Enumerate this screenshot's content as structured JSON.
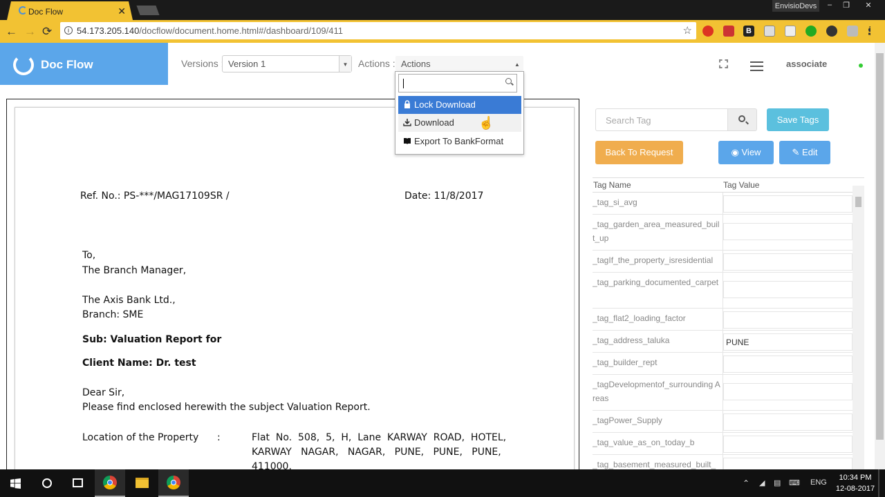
{
  "browser": {
    "tab_title": "Doc Flow",
    "tab_close": "✕",
    "window_user": "EnvisioDevs",
    "minimize": "–",
    "restore": "❐",
    "close": "✕",
    "back": "←",
    "forward": "→",
    "reload": "⟳",
    "url_host": "54.173.205.140",
    "url_path": "/docflow/document.home.html#/dashboard/109/411",
    "bookmark": "☆"
  },
  "app": {
    "brand": "Doc Flow",
    "versions_label": "Versions :",
    "version_selected": "Version 1",
    "actions_label": "Actions :",
    "actions_selected": "Actions",
    "user": "associate"
  },
  "dropdown": {
    "items": [
      "Lock Download",
      "Download",
      "Export To BankFormat"
    ]
  },
  "document": {
    "ref": "Ref. No.: PS-***/MAG17109SR /",
    "date": "Date: 11/8/2017",
    "to": "To,",
    "recipient": "The Branch Manager,",
    "bank": "The Axis Bank Ltd.,",
    "branch": "Branch: SME",
    "subject": "Sub: Valuation  Report for",
    "client": "Client Name: Dr. test",
    "greeting": "Dear Sir,",
    "body": "Please find enclosed herewith the subject Valuation Report.",
    "location_label": "Location of the Property",
    "colon": ":",
    "location_line1": "Flat  No.  508,  5,  H,  Lane  KARWAY  ROAD,  HOTEL,",
    "location_line2": "KARWAY   NAGAR,   NAGAR,   PUNE,   PUNE,   PUNE,",
    "location_line3": "411000."
  },
  "tags": {
    "search_placeholder": "Search Tag",
    "save_label": "Save Tags",
    "back_label": "Back To Request",
    "view_label": "View",
    "edit_label": "Edit",
    "col_name": "Tag Name",
    "col_value": "Tag Value",
    "rows": [
      {
        "name": "_tag_si_avg",
        "value": ""
      },
      {
        "name": "_tag_garden_area_measured_built_up",
        "value": ""
      },
      {
        "name": "_tagIf_the_property_isresidential",
        "value": ""
      },
      {
        "name": "_tag_parking_documented_carpet",
        "value": ""
      },
      {
        "name": "_tag_flat2_loading_factor",
        "value": ""
      },
      {
        "name": "_tag_address_taluka",
        "value": "PUNE"
      },
      {
        "name": "_tag_builder_rept",
        "value": ""
      },
      {
        "name": "_tagDevelopmentof_surrounding Areas",
        "value": ""
      },
      {
        "name": "_tagPower_Supply",
        "value": ""
      },
      {
        "name": "_tag_value_as_on_today_b",
        "value": ""
      },
      {
        "name": "_tag_basement_measured_built_",
        "value": ""
      }
    ]
  },
  "taskbar": {
    "lang": "ENG",
    "time": "10:34 PM",
    "date": "12-08-2017"
  },
  "colors": {
    "brand": "#5ba6ea",
    "chrome": "#f2c233",
    "save": "#5bc0de",
    "back": "#f0ad4e",
    "view_edit": "#5ba6ea",
    "dropdown_active": "#3a7bd5"
  }
}
